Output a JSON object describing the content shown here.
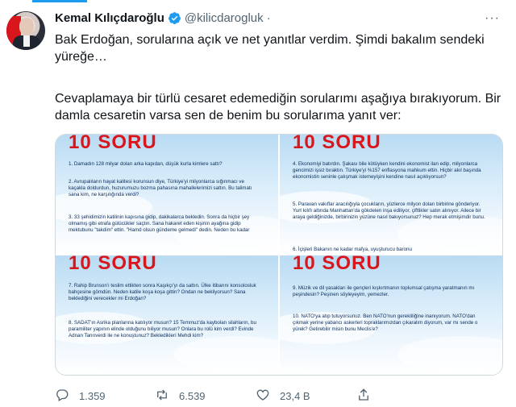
{
  "author": {
    "name": "Kemal Kılıçdaroğlu",
    "handle": "@kilicdarogluk",
    "separator": "·"
  },
  "more_label": "···",
  "tweet": {
    "line1": "Bak Erdoğan, sorularına açık ve net yanıtlar verdim. Şimdi bakalım sendeki yüreğe…",
    "line2": "Cevaplamaya bir türlü cesaret edemediğin sorularımı aşağıya bırakıyorum. Bir damla cesaretin varsa sen de benim bu sorularıma yanıt ver:"
  },
  "media": {
    "panels": [
      {
        "title": "10 SORU",
        "questions": [
          "1. Damadın 128 milyar doları arka kapıdan, düşük kurla kimlere sattı?",
          "2. Avrupalıların hayat kalitesi korunsun diye, Türkiye'yi milyonlarca sığınmacı ve kaçakla doldurdun, huzurumuzu bozma pahasına mahallelerimizi sattın. Bu talimatı sana kim, ne karşılığında verdi?",
          "3. 33 şehidimizin katilinin kapısına gidip, dakikalarca bekledin. Sonra da hiçbir şey olmamış gibi etrafa gülücükler saçtın. Sana hakaret eden kişinin ayağına gidip mektubunu \"takdim\" ettin. \"Hamd olsun gündeme gelmedi\" dedin. Neden bu kadar"
        ]
      },
      {
        "title": "10 SORU",
        "questions": [
          "4. Ekonomiyi batırdın. Şakası bile kötüyken kendini ekonomist ilan edip, milyonlarca gencimizi işsiz bıraktın. Türkiye'yi %157 enflasyona mahkum ettin. Hiçbir akıl başında ekonomistin seninle çalışmak istemeyişini kendine nasıl açıklıyorsun?",
          "5. Paravan vakıflar aracılığıyla çocukların, yüzlerce milyon doları birbirine gönderiyor. Yurt kılıfı altında Manhattan'da gökdelen inşa ediliyor, çiftlikler satın alınıyor. Ailece bir araya geldiğinizde, birbirinizin yüzüne nasıl bakıyorsunuz? Hep merak etmişimdir bunu.",
          "6. İçişleri Bakanın ne kadar mafya, uyuşturucu baronu"
        ]
      },
      {
        "title": "10 SORU",
        "questions": [
          "7. Rahip Brunson'ı teslim ettikten sonra Kaşıkçı'yı da sattın. Ülke itibarını konsolosluk bahçesine gömdün. Neden katile koşa koşa gittin? Ondan ne bekliyorsun? Sana beklediğini verecekler mi Erdoğan?",
          "8. SADAT'ın Asrika planlarına katılıyor musun? 15 Temmuz'da kaybolan silahların, bu paramiliter yapının elinde olduğunu biliyor musun? Onlara bu rolü kim verdi? Evinde Adnan Tanrıverdi ile ne konuştunuz? Beklediklerí Mehdi kim?"
        ]
      },
      {
        "title": "10 SORU",
        "questions": [
          "9. Müzik ve dil yasakları ile gençleri kışkırtmanın toplumsal çatışma yaratmanın mı peşindesin? Peşinen söyleyeyim, yemezler.",
          "10. NATO'ya atıp tutuyorsunuz. Ben NATO'nun gerekliliğine inanıyorum. NATO'dan çıkmak yerine yabancı askerleri topraklarımızdan çıkaralım diyorum, var mı sende o yürek? Getirebilir misin bunu Meclis'e?"
        ]
      }
    ]
  },
  "actions": {
    "replies": "1.359",
    "retweets": "6.539",
    "likes": "23,4 B",
    "share": ""
  },
  "colors": {
    "accent": "#1d9bf0",
    "title_red": "#d8161b",
    "muted": "#536471"
  }
}
